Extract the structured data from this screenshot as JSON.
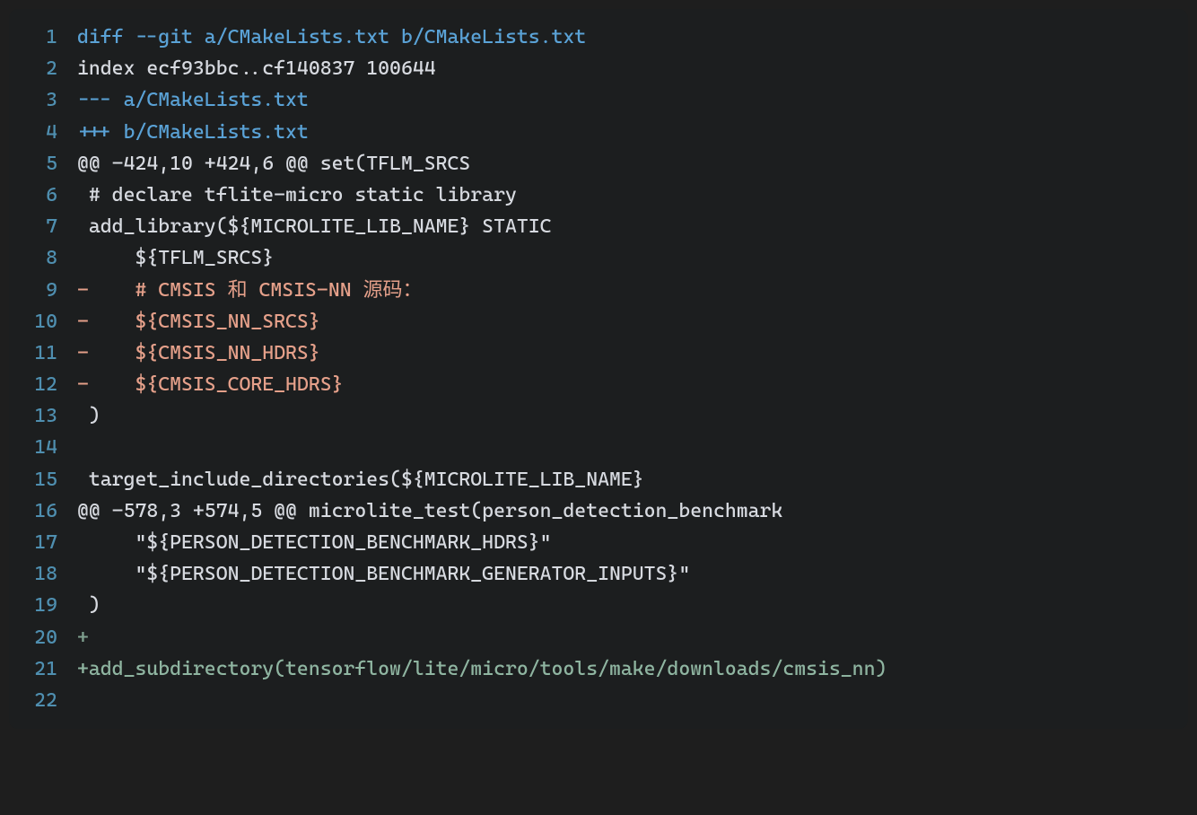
{
  "colors": {
    "background": "#1c1e1f",
    "gutter": "#4f8fb0",
    "meta": "#5aa2d6",
    "plain": "#d7dae0",
    "deleted": "#e5a08a",
    "added": "#8fb5a1"
  },
  "lines": [
    {
      "num": "1",
      "cls": "tok-meta",
      "text": "diff --git a/CMakeLists.txt b/CMakeLists.txt"
    },
    {
      "num": "2",
      "cls": "tok-plain",
      "text": "index ecf93bbc..cf140837 100644"
    },
    {
      "num": "3",
      "cls": "tok-meta",
      "text": "--- a/CMakeLists.txt"
    },
    {
      "num": "4",
      "cls": "tok-meta",
      "text": "+++ b/CMakeLists.txt"
    },
    {
      "num": "5",
      "cls": "tok-plain",
      "text": "@@ -424,10 +424,6 @@ set(TFLM_SRCS"
    },
    {
      "num": "6",
      "cls": "tok-plain",
      "text": " # declare tflite-micro static library"
    },
    {
      "num": "7",
      "cls": "tok-plain",
      "text": " add_library(${MICROLITE_LIB_NAME} STATIC"
    },
    {
      "num": "8",
      "cls": "tok-plain",
      "text": "     ${TFLM_SRCS}"
    },
    {
      "num": "9",
      "cls": "tok-del",
      "text": "-    # CMSIS 和 CMSIS-NN 源码："
    },
    {
      "num": "10",
      "cls": "tok-del",
      "text": "-    ${CMSIS_NN_SRCS}"
    },
    {
      "num": "11",
      "cls": "tok-del",
      "text": "-    ${CMSIS_NN_HDRS}"
    },
    {
      "num": "12",
      "cls": "tok-del",
      "text": "-    ${CMSIS_CORE_HDRS}"
    },
    {
      "num": "13",
      "cls": "tok-plain",
      "text": " )"
    },
    {
      "num": "14",
      "cls": "tok-plain",
      "text": ""
    },
    {
      "num": "15",
      "cls": "tok-plain",
      "text": " target_include_directories(${MICROLITE_LIB_NAME}"
    },
    {
      "num": "16",
      "cls": "tok-plain",
      "text": "@@ -578,3 +574,5 @@ microlite_test(person_detection_benchmark"
    },
    {
      "num": "17",
      "cls": "tok-plain",
      "text": "     \"${PERSON_DETECTION_BENCHMARK_HDRS}\""
    },
    {
      "num": "18",
      "cls": "tok-plain",
      "text": "     \"${PERSON_DETECTION_BENCHMARK_GENERATOR_INPUTS}\""
    },
    {
      "num": "19",
      "cls": "tok-plain",
      "text": " )"
    },
    {
      "num": "20",
      "cls": "tok-add-dim",
      "text": "+"
    },
    {
      "num": "21",
      "cls": "tok-add",
      "text": "+add_subdirectory(tensorflow/lite/micro/tools/make/downloads/cmsis_nn)"
    },
    {
      "num": "22",
      "cls": "tok-plain",
      "text": ""
    }
  ]
}
